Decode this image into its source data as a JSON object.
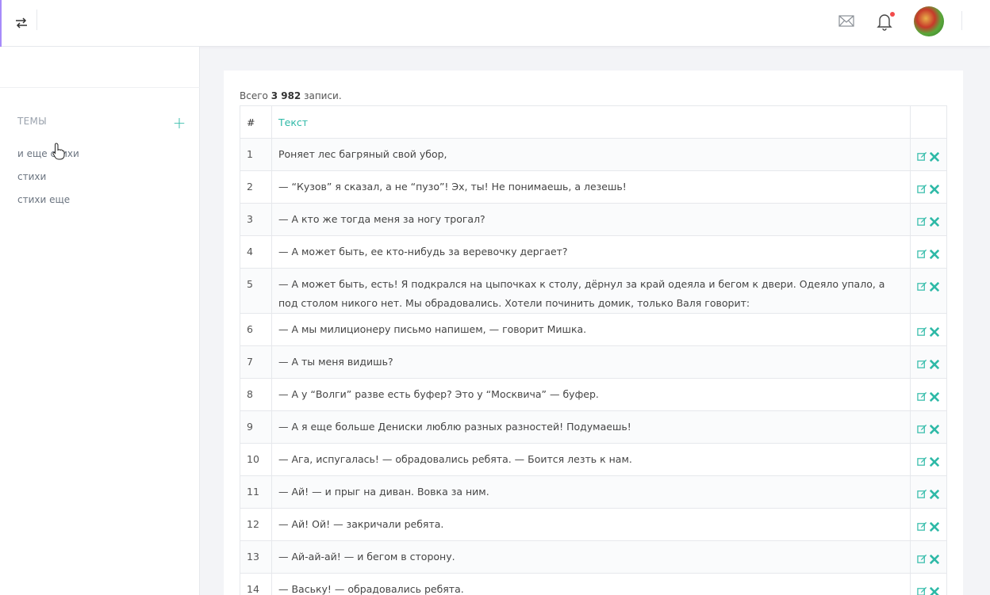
{
  "header": {
    "toggle_icon": "transfer-arrows-icon",
    "mail_icon": "mail-icon",
    "bell_icon": "bell-icon",
    "accent_color": "#a78bfa",
    "notification_dot_color": "#f24b4b"
  },
  "sidebar": {
    "topics_title": "ТЕМЫ",
    "add_label": "+",
    "items": [
      {
        "label": "и еще стихи"
      },
      {
        "label": "стихи"
      },
      {
        "label": "стихи еще"
      }
    ]
  },
  "main": {
    "summary_prefix": "Всего ",
    "summary_count": "3 982",
    "summary_suffix": " записи.",
    "table": {
      "col_num": "#",
      "col_text": "Текст",
      "rows": [
        {
          "num": "1",
          "text": "Роняет лес багряный свой убор,"
        },
        {
          "num": "2",
          "text": "— “Кузов” я сказал, а не “пузо”! Эх, ты! Не понимаешь, а лезешь!"
        },
        {
          "num": "3",
          "text": "— А кто же тогда меня за ногу трогал?"
        },
        {
          "num": "4",
          "text": "— А может быть, ее кто-нибудь за веревочку дергает?"
        },
        {
          "num": "5",
          "text": "— А может быть, есть! Я подкрался на цыпочках к столу, дёрнул за край одеяла и бегом к двери. Одеяло упало, а под столом никого нет. Мы обрадовались. Хотели починить домик, только Валя говорит:"
        },
        {
          "num": "6",
          "text": "— А мы милиционеру письмо напишем, — говорит Мишка."
        },
        {
          "num": "7",
          "text": "— А ты меня видишь?"
        },
        {
          "num": "8",
          "text": "— А у “Волги” разве есть буфер? Это у “Москвича” — буфер."
        },
        {
          "num": "9",
          "text": "— А я еще больше Дениски люблю разных разностей! Подумаешь!"
        },
        {
          "num": "10",
          "text": "— Ага, испугалась! — обрадовались ребята. — Боится лезть к нам."
        },
        {
          "num": "11",
          "text": "— Ай! — и прыг на диван. Вовка за ним."
        },
        {
          "num": "12",
          "text": "— Ай! Ой! — закричали ребята."
        },
        {
          "num": "13",
          "text": "— Ай-ай-ай! — и бегом в сторону."
        },
        {
          "num": "14",
          "text": "— Ваську! — обрадовались ребята."
        }
      ]
    }
  },
  "colors": {
    "teal": "#2eb9a7",
    "edit_icon_color": "#3dbfae",
    "delete_icon_color": "#2eb9a7"
  }
}
